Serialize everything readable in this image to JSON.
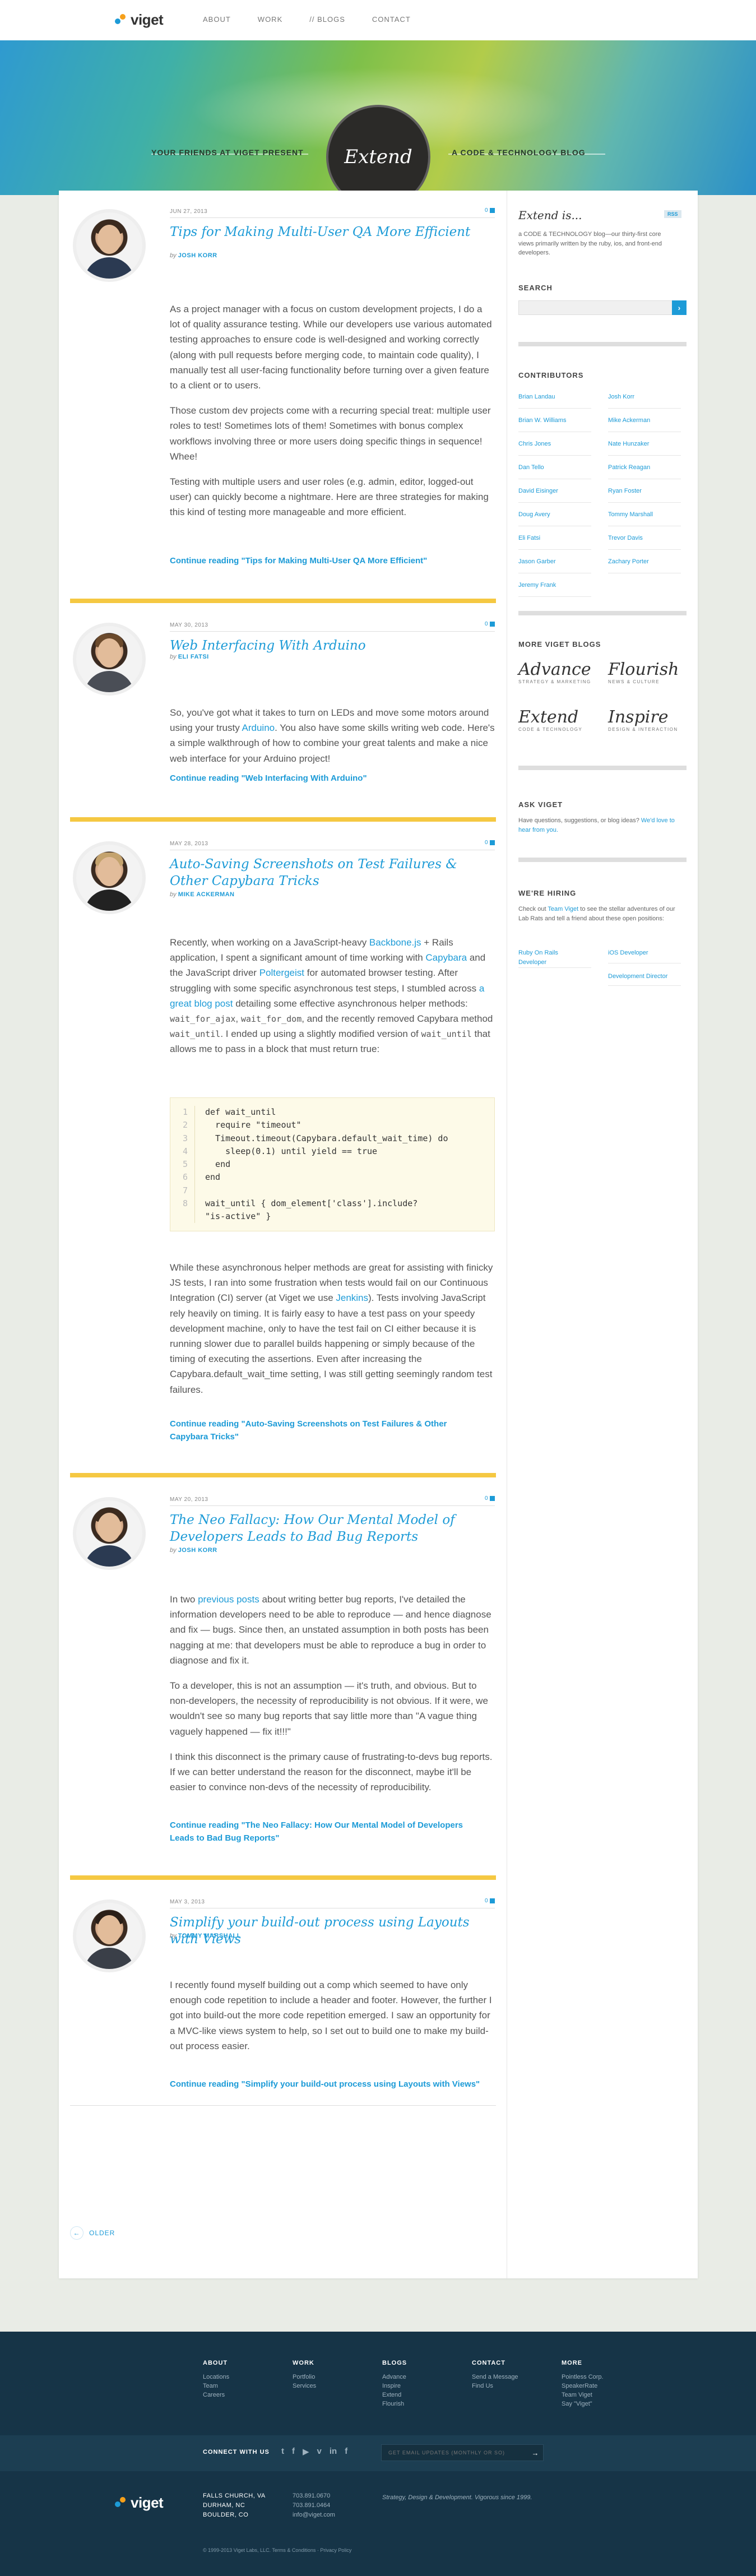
{
  "brand": {
    "logo_text": "viget"
  },
  "nav": {
    "items": [
      "ABOUT",
      "WORK",
      "// BLOGS",
      "CONTACT"
    ]
  },
  "hero": {
    "left": "YOUR FRIENDS AT VIGET PRESENT",
    "badge": "Extend",
    "right": "A CODE & TECHNOLOGY BLOG"
  },
  "posts": [
    {
      "date": "JUN 27, 2013",
      "comments": "0",
      "title": "Tips for Making Multi-User QA More Efficient",
      "by": "by",
      "author": "JOSH KORR",
      "paragraphs": [
        "As a project manager with a focus on custom development projects, I do a lot of quality assurance testing. While our developers use various automated testing approaches to ensure code is well-designed and working correctly (along with pull requests before merging code, to maintain code quality), I manually test all user-facing functionality before turning over a given feature to a client or to users.",
        "Those custom dev projects come with a recurring special treat: multiple user roles to test! Sometimes lots of them! Sometimes with bonus complex workflows involving three or more users doing specific things in sequence! Whee!",
        "Testing with multiple users and user roles (e.g. admin, editor, logged-out user) can quickly become a nightmare. Here are three strategies for making this kind of testing more manageable and more efficient."
      ],
      "more": "Continue reading \"Tips for Making Multi-User QA More Efficient\""
    },
    {
      "date": "MAY 30, 2013",
      "comments": "0",
      "title": "Web Interfacing With Arduino",
      "by": "by",
      "author": "ELI FATSI",
      "p1_a": "So, you've got what it takes to turn on LEDs and move some motors around using your trusty ",
      "p1_link": "Arduino",
      "p1_b": ". You also have some skills writing web code. Here's a simple walkthrough of how to combine your great talents and make a nice web interface for your Arduino project!",
      "more": "Continue reading \"Web Interfacing With Arduino\""
    },
    {
      "date": "MAY 28, 2013",
      "comments": "0",
      "title": "Auto-Saving Screenshots on Test Failures & Other Capybara Tricks",
      "by": "by",
      "author": "MIKE ACKERMAN",
      "p1_a": "Recently, when working on a JavaScript-heavy ",
      "p1_l1": "Backbone.js",
      "p1_b": " + Rails application, I spent a significant amount of time working with ",
      "p1_l2": "Capybara",
      "p1_c": " and the JavaScript driver ",
      "p1_l3": "Poltergeist",
      "p1_d": " for automated browser testing. After struggling with some specific asynchronous test steps, I stumbled across ",
      "p1_l4": "a great blog post",
      "p1_e": " detailing some effective asynchronous helper methods: ",
      "p1_c1": "wait_for_ajax",
      "p1_c2": "wait_for_dom",
      "p1_f": ", and the recently removed Capybara method ",
      "p1_c3": "wait_until",
      "p1_g": ". I ended up using a slightly modified version of ",
      "p1_c4": "wait_until",
      "p1_h": " that allows me to pass in a block that must return true:",
      "code": [
        {
          "n": "1",
          "t": "def wait_until"
        },
        {
          "n": "2",
          "t": "  require \"timeout\""
        },
        {
          "n": "3",
          "t": "  Timeout.timeout(Capybara.default_wait_time) do"
        },
        {
          "n": "4",
          "t": "    sleep(0.1) until yield == true"
        },
        {
          "n": "5",
          "t": "  end"
        },
        {
          "n": "6",
          "t": "end"
        },
        {
          "n": "7",
          "t": ""
        },
        {
          "n": "8",
          "t": "wait_until { dom_element['class'].include?"
        },
        {
          "n": "",
          "t": "\"is-active\" }"
        }
      ],
      "p2_a": "While these asynchronous helper methods are great for assisting with finicky JS tests, I ran into some frustration when tests would fail on our Continuous Integration (CI) server (at Viget we use ",
      "p2_link": "Jenkins",
      "p2_b": "). Tests involving JavaScript rely heavily on timing. It is fairly easy to have a test pass on your speedy development machine, only to have the test fail on CI either because it is running slower due to parallel builds happening or simply because of the timing of executing the assertions. Even after increasing the Capybara.default_wait_time setting, I was still getting seemingly random test failures.",
      "more": "Continue reading \"Auto-Saving Screenshots on Test Failures & Other Capybara Tricks\""
    },
    {
      "date": "MAY 20, 2013",
      "comments": "0",
      "title": "The Neo Fallacy: How Our Mental Model of Developers Leads to Bad Bug Reports",
      "by": "by",
      "author": "JOSH KORR",
      "p1_a": "In two ",
      "p1_link": "previous posts",
      "p1_b": " about writing better bug reports, I've detailed the information developers need to be able to reproduce — and hence diagnose and fix — bugs. Since then, an unstated assumption in both posts has been nagging at me: that developers must be able to reproduce a bug in order to diagnose and fix it.",
      "p2": "To a developer, this is not an assumption — it's truth, and obvious. But to non-developers, the necessity of reproducibility is not obvious. If it were, we wouldn't see so many bug reports that say little more than \"A vague thing vaguely happened — fix it!!!\"",
      "p3": "I think this disconnect is the primary cause of frustrating-to-devs bug reports. If we can better understand the reason for the disconnect, maybe it'll be easier to convince non-devs of the necessity of reproducibility.",
      "more": "Continue reading \"The Neo Fallacy: How Our Mental Model of Developers Leads to Bad Bug Reports\""
    },
    {
      "date": "MAY 3, 2013",
      "comments": "0",
      "title": "Simplify your build-out process using Layouts with Views",
      "by": "by",
      "author": "TOMMY MARSHALL",
      "p1": "I recently found myself building out a comp which seemed to have only enough code repetition to include a header and footer. However, the further I got into build-out the more code repetition emerged. I saw an opportunity for a MVC-like views system to help, so I set out to build one to make my build-out process easier.",
      "more": "Continue reading \"Simplify your build-out process using Layouts with Views\""
    }
  ],
  "older": "OLDER",
  "sidebar": {
    "title": "Extend is...",
    "rss": "RSS",
    "intro": "a CODE & TECHNOLOGY blog—our thirty-first core views primarily written by the ruby, ios, and front-end developers.",
    "search_title": "SEARCH",
    "search_go": "›",
    "contributors_title": "CONTRIBUTORS",
    "contributors": [
      "Brian Landau",
      "Josh Korr",
      "Brian W. Williams",
      "Mike Ackerman",
      "Chris Jones",
      "Nate Hunzaker",
      "Dan Tello",
      "Patrick Reagan",
      "David Eisinger",
      "Ryan Foster",
      "Doug Avery",
      "Tommy Marshall",
      "Eli Fatsi",
      "Trevor Davis",
      "Jason Garber",
      "Zachary Porter",
      "Jeremy Frank"
    ],
    "more_blogs_title": "MORE VIGET BLOGS",
    "blogs": [
      {
        "name": "Advance",
        "sub": "STRATEGY & MARKETING"
      },
      {
        "name": "Flourish",
        "sub": "NEWS & CULTURE"
      },
      {
        "name": "Extend",
        "sub": "CODE & TECHNOLOGY"
      },
      {
        "name": "Inspire",
        "sub": "DESIGN & INTERACTION"
      }
    ],
    "ask_title": "ASK VIGET",
    "ask_text": "Have questions, suggestions, or blog ideas? ",
    "ask_link": "We'd love to hear from you.",
    "hiring_title": "WE'RE HIRING",
    "hiring_text_a": "Check out ",
    "hiring_link": "Team Viget",
    "hiring_text_b": " to see the stellar adventures of our Lab Rats and tell a friend about these open positions:",
    "jobs": [
      "Ruby On Rails Developer",
      "iOS Developer",
      "Development Director"
    ]
  },
  "footer": {
    "columns": [
      {
        "title": "ABOUT",
        "items": [
          "Locations",
          "Team",
          "Careers"
        ]
      },
      {
        "title": "WORK",
        "items": [
          "Portfolio",
          "Services"
        ]
      },
      {
        "title": "BLOGS",
        "items": [
          "Advance",
          "Inspire",
          "Extend",
          "Flourish"
        ]
      },
      {
        "title": "CONTACT",
        "items": [
          "Send a Message",
          "Find Us"
        ]
      },
      {
        "title": "MORE",
        "items": [
          "Pointless Corp.",
          "SpeakerRate",
          "Team Viget",
          "Say \"Viget\""
        ]
      }
    ],
    "connect": "CONNECT WITH US",
    "social": [
      "t",
      "f",
      "▶",
      "v",
      "in",
      "f"
    ],
    "email_placeholder": "GET EMAIL UPDATES (MONTHLY OR SO)",
    "email_go": "→",
    "address": [
      "FALLS CHURCH, VA",
      "DURHAM, NC",
      "BOULDER, CO"
    ],
    "contact": [
      "703.891.0670",
      "703.891.0464",
      "info@viget.com"
    ],
    "tagline": "Strategy, Design & Development. Vigorous since 1999.",
    "copyright": "© 1999-2013 Viget Labs, LLC. Terms & Conditions · Privacy Policy"
  }
}
